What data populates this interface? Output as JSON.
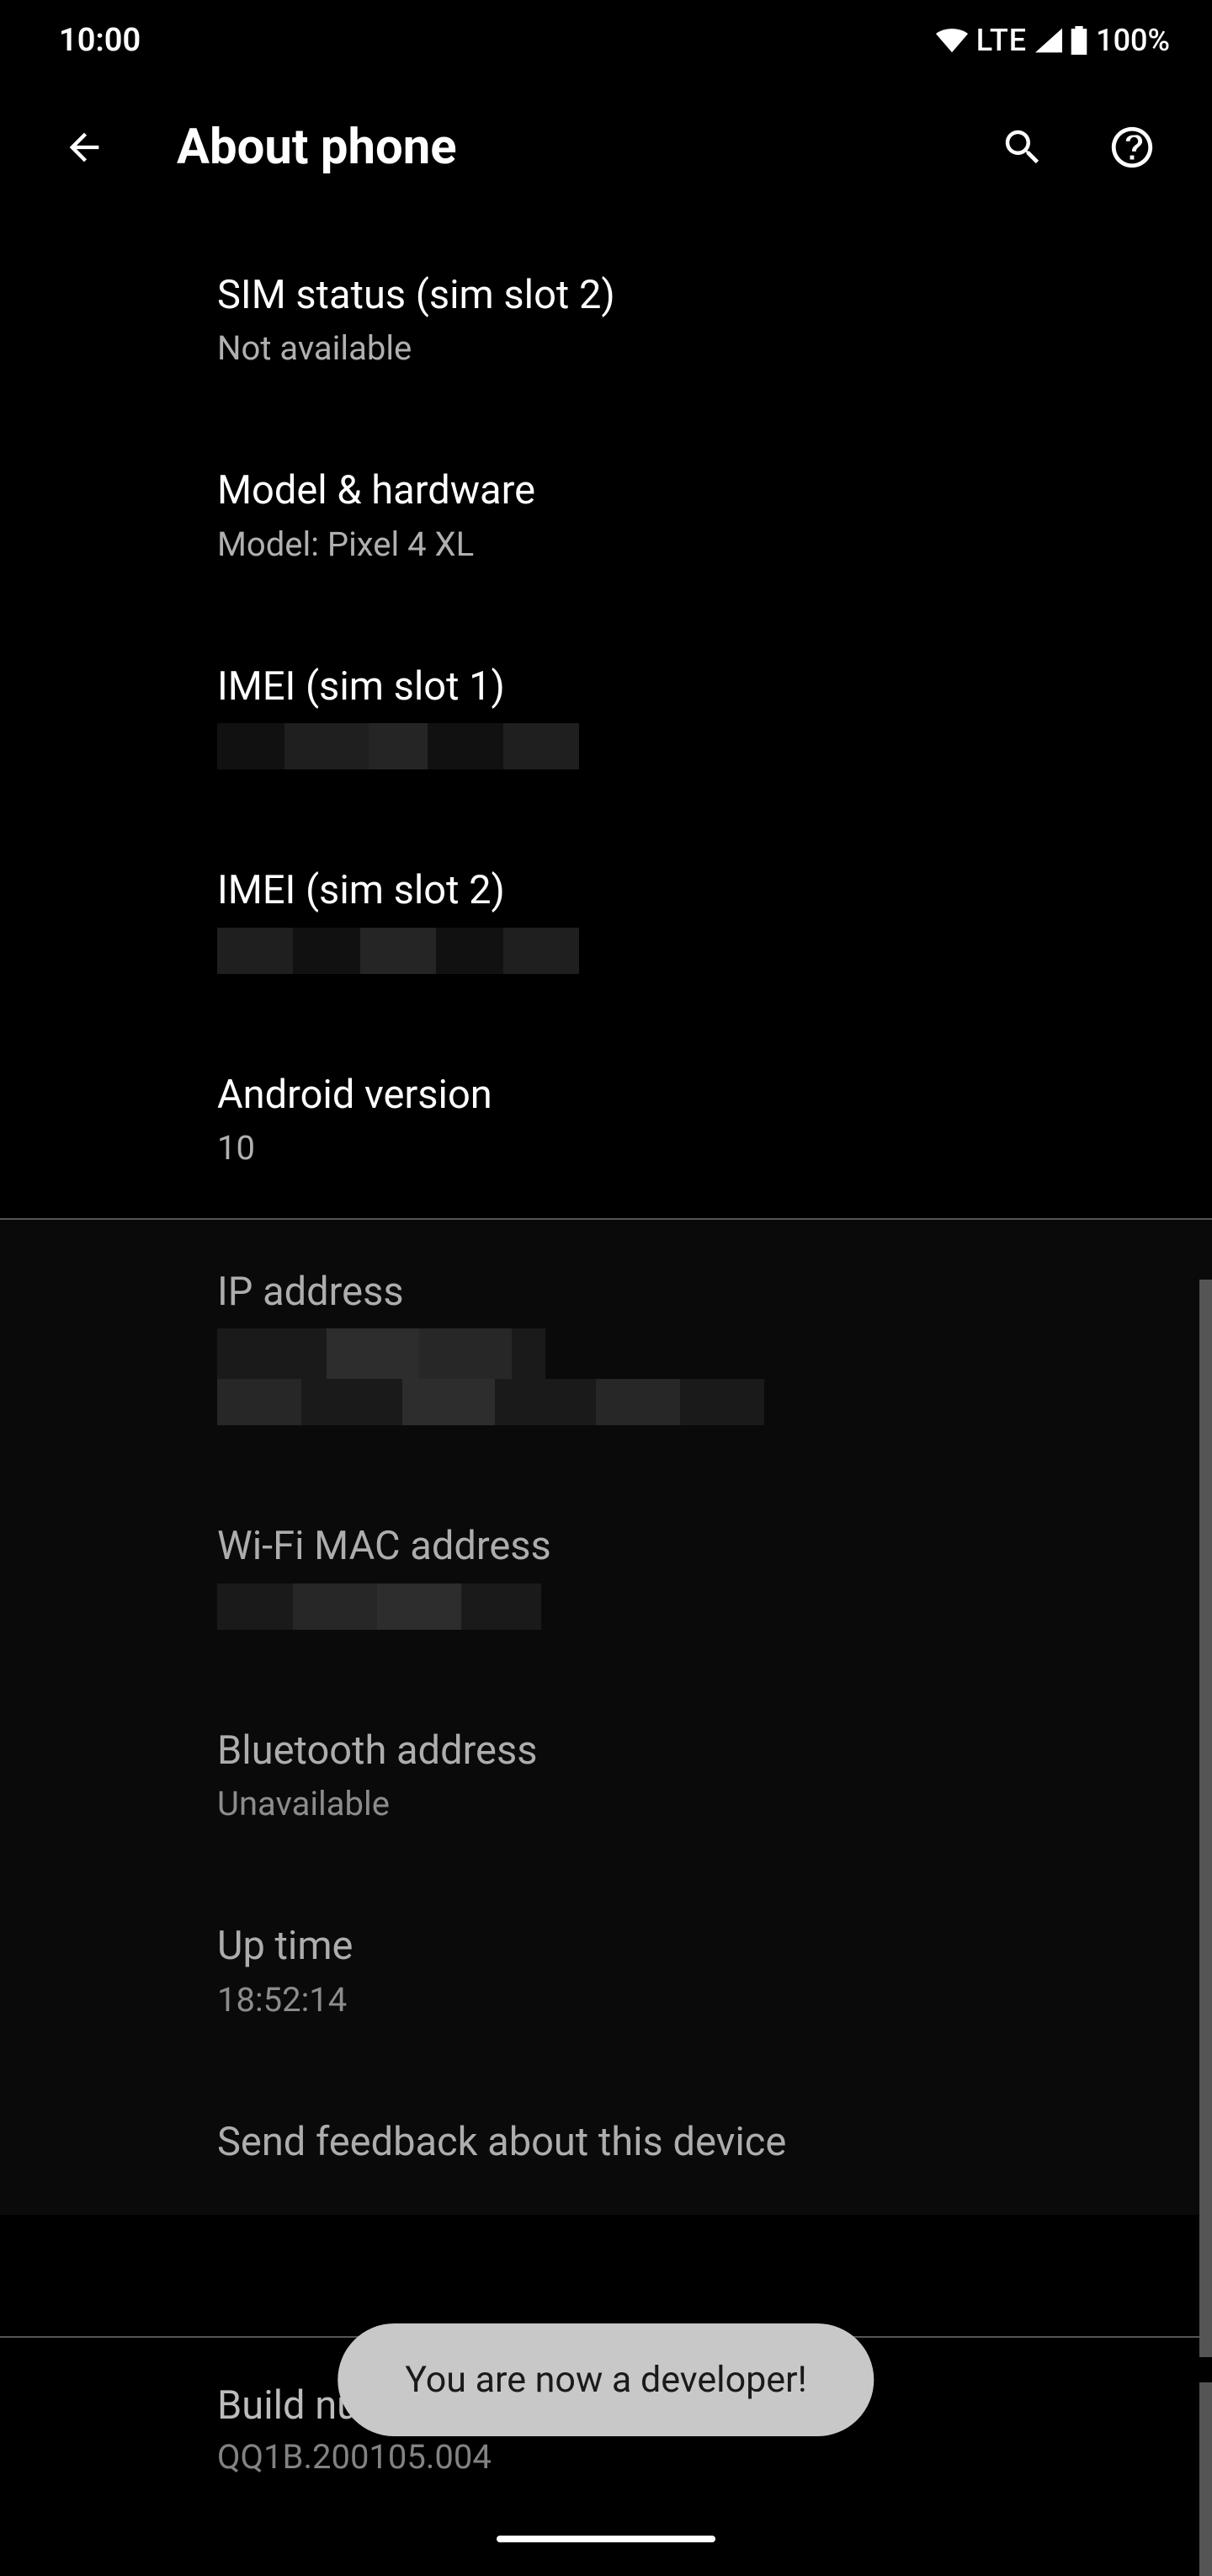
{
  "status_bar": {
    "time": "10:00",
    "network": "LTE",
    "battery": "100%"
  },
  "header": {
    "title": "About phone"
  },
  "items": {
    "sim2": {
      "label": "SIM status (sim slot 2)",
      "value": "Not available"
    },
    "model": {
      "label": "Model & hardware",
      "value": "Model: Pixel 4 XL"
    },
    "imei1": {
      "label": "IMEI (sim slot 1)"
    },
    "imei2": {
      "label": "IMEI (sim slot 2)"
    },
    "android": {
      "label": "Android version",
      "value": "10"
    },
    "ip": {
      "label": "IP address"
    },
    "mac": {
      "label": "Wi-Fi MAC address"
    },
    "bt": {
      "label": "Bluetooth address",
      "value": "Unavailable"
    },
    "uptime": {
      "label": "Up time",
      "value": "18:52:14"
    },
    "feedback": {
      "label": "Send feedback about this device"
    },
    "build": {
      "label": "Build number",
      "value": "QQ1B.200105.004"
    }
  },
  "toast": {
    "message": "You are now a developer!"
  }
}
